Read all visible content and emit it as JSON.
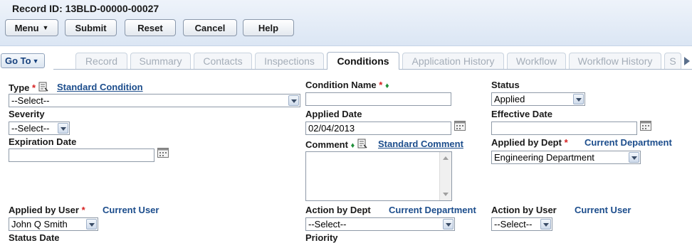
{
  "record": {
    "title": "Record ID: 13BLD-00000-00027"
  },
  "toolbar": {
    "menu": "Menu",
    "submit": "Submit",
    "reset": "Reset",
    "cancel": "Cancel",
    "help": "Help"
  },
  "nav": {
    "goto": "Go To",
    "tabs": [
      "Record",
      "Summary",
      "Contacts",
      "Inspections",
      "Conditions",
      "Application History",
      "Workflow",
      "Workflow History",
      "S"
    ],
    "active_tab": "Conditions"
  },
  "form": {
    "type_label": "Type",
    "type_link": "Standard Condition",
    "type_value": "--Select--",
    "severity_label": "Severity",
    "severity_value": "--Select--",
    "expiration_label": "Expiration Date",
    "expiration_value": "",
    "applied_by_user_label": "Applied by User",
    "applied_by_user_link": "Current User",
    "applied_by_user_value": "John Q Smith",
    "status_date_label": "Status Date",
    "condition_name_label": "Condition Name",
    "condition_name_value": "",
    "applied_date_label": "Applied Date",
    "applied_date_value": "02/04/2013",
    "comment_label": "Comment",
    "comment_link": "Standard Comment",
    "comment_value": "",
    "action_by_dept_label": "Action by Dept",
    "action_by_dept_link": "Current Department",
    "action_by_dept_value": "--Select--",
    "priority_label": "Priority",
    "status_label": "Status",
    "status_value": "Applied",
    "effective_label": "Effective Date",
    "effective_value": "",
    "applied_by_dept_label": "Applied by Dept",
    "applied_by_dept_link": "Current Department",
    "applied_by_dept_value": "Engineering Department",
    "action_by_user_label": "Action by User",
    "action_by_user_link": "Current User",
    "action_by_user_value": "--Select--"
  },
  "colors": {
    "required": "#d62020",
    "link": "#1c4d8c",
    "diamond": "#1f8f3a"
  }
}
